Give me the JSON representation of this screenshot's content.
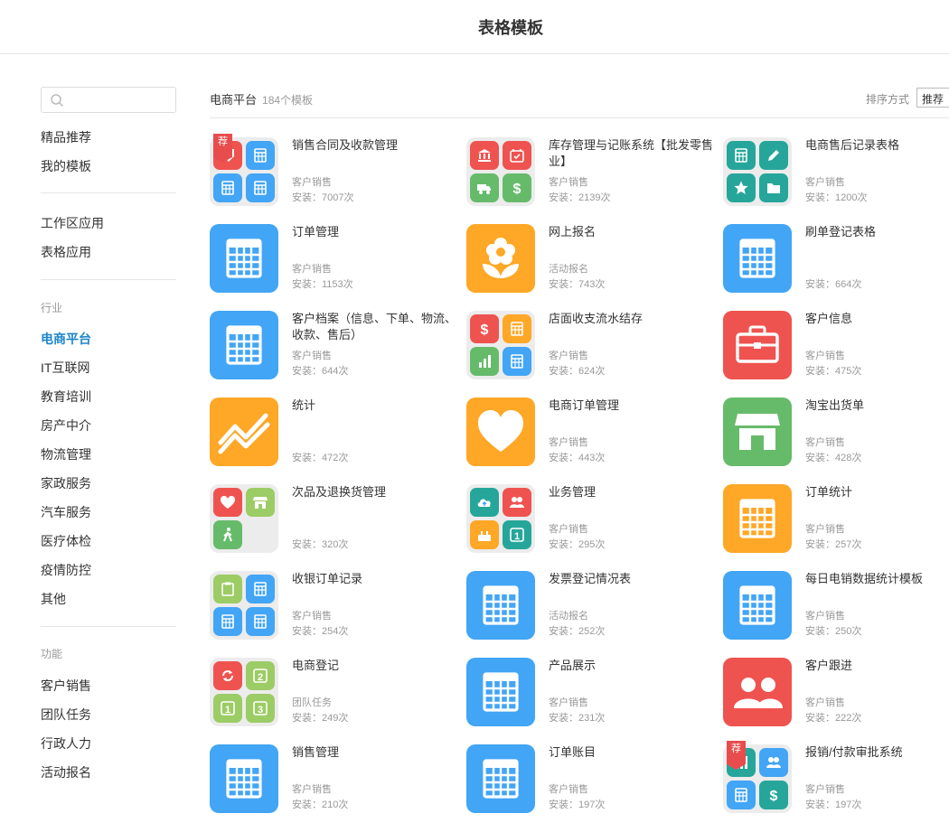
{
  "header": {
    "title": "表格模板"
  },
  "sidebar": {
    "search_placeholder": "",
    "top_items": [
      "精品推荐",
      "我的模板"
    ],
    "app_items": [
      "工作区应用",
      "表格应用"
    ],
    "industry_header": "行业",
    "industry_items": [
      "电商平台",
      "IT互联网",
      "教育培训",
      "房产中介",
      "物流管理",
      "家政服务",
      "汽车服务",
      "医疗体检",
      "疫情防控",
      "其他"
    ],
    "active_item": "电商平台",
    "function_header": "功能",
    "function_items": [
      "客户销售",
      "团队任务",
      "行政人力",
      "活动报名"
    ]
  },
  "content": {
    "category": "电商平台",
    "count": "184个模板",
    "sort_label": "排序方式",
    "sort_value": "推荐"
  },
  "colors": {
    "blue": "#42a5f5",
    "red": "#ef5350",
    "orange": "#ffa726",
    "green": "#66bb6a",
    "teal": "#26a69a",
    "lightgreen": "#9ccc65",
    "active_link": "#1d86c8"
  },
  "templates": [
    {
      "name": "销售合同及收款管理",
      "category": "客户销售",
      "installs": "安装：7007次",
      "icon": "quad-sales-contract",
      "badge": "荐"
    },
    {
      "name": "库存管理与记账系统【批发零售业】",
      "category": "客户销售",
      "installs": "安装：2139次",
      "icon": "quad-inventory"
    },
    {
      "name": "电商售后记录表格",
      "category": "客户销售",
      "installs": "安装：1200次",
      "icon": "quad-aftersale"
    },
    {
      "name": "订单管理",
      "category": "客户销售",
      "installs": "安装：1153次",
      "icon": "table-icon"
    },
    {
      "name": "网上报名",
      "category": "活动报名",
      "installs": "安装：743次",
      "icon": "flower-icon"
    },
    {
      "name": "刷单登记表格",
      "category": "",
      "installs": "安装：664次",
      "icon": "table-icon"
    },
    {
      "name": "客户档案（信息、下单、物流、收款、售后）",
      "category": "客户销售",
      "installs": "安装：644次",
      "icon": "table-icon"
    },
    {
      "name": "店面收支流水结存",
      "category": "客户销售",
      "installs": "安装：624次",
      "icon": "quad-cashflow"
    },
    {
      "name": "客户信息",
      "category": "客户销售",
      "installs": "安装：475次",
      "icon": "briefcase-icon"
    },
    {
      "name": "统计",
      "category": "",
      "installs": "安装：472次",
      "icon": "trend-icon"
    },
    {
      "name": "电商订单管理",
      "category": "客户销售",
      "installs": "安装：443次",
      "icon": "heart-icon"
    },
    {
      "name": "淘宝出货单",
      "category": "客户销售",
      "installs": "安装：428次",
      "icon": "store-icon"
    },
    {
      "name": "次品及退换货管理",
      "category": "",
      "installs": "安装：320次",
      "icon": "quad-returns"
    },
    {
      "name": "业务管理",
      "category": "客户销售",
      "installs": "安装：295次",
      "icon": "quad-business"
    },
    {
      "name": "订单统计",
      "category": "客户销售",
      "installs": "安装：257次",
      "icon": "table-icon"
    },
    {
      "name": "收银订单记录",
      "category": "客户销售",
      "installs": "安装：254次",
      "icon": "quad-cashier"
    },
    {
      "name": "发票登记情况表",
      "category": "活动报名",
      "installs": "安装：252次",
      "icon": "table-icon"
    },
    {
      "name": "每日电销数据统计模板",
      "category": "客户销售",
      "installs": "安装：250次",
      "icon": "table-icon"
    },
    {
      "name": "电商登记",
      "category": "团队任务",
      "installs": "安装：249次",
      "icon": "quad-ecommerce-register"
    },
    {
      "name": "产品展示",
      "category": "客户销售",
      "installs": "安装：231次",
      "icon": "table-icon"
    },
    {
      "name": "客户跟进",
      "category": "客户销售",
      "installs": "安装：222次",
      "icon": "people-icon"
    },
    {
      "name": "销售管理",
      "category": "客户销售",
      "installs": "安装：210次",
      "icon": "table-icon"
    },
    {
      "name": "订单账目",
      "category": "客户销售",
      "installs": "安装：197次",
      "icon": "table-icon"
    },
    {
      "name": "报销/付款审批系统",
      "category": "客户销售",
      "installs": "安装：197次",
      "icon": "quad-reimbursement",
      "badge": "荐"
    }
  ]
}
